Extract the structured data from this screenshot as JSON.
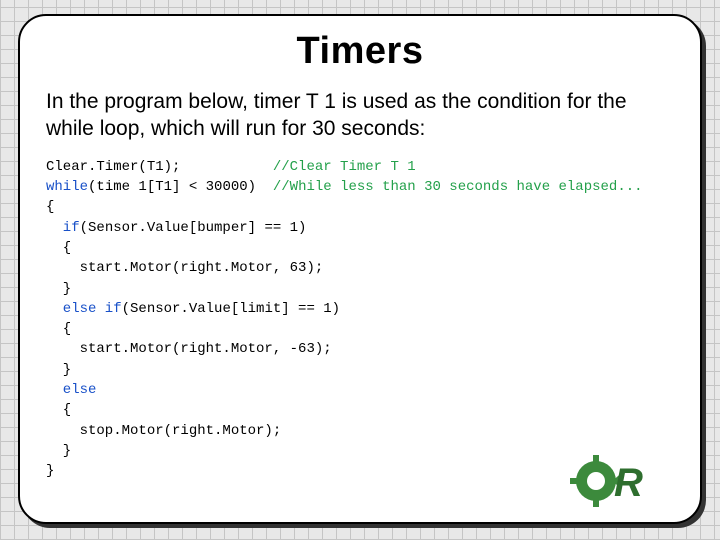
{
  "slide": {
    "title": "Timers",
    "intro": "In the program below, timer T 1 is used as the condition for the while loop, which will run for 30 seconds:",
    "code": {
      "l1a": "Clear.Timer(T1);",
      "l1b": "//Clear Timer T 1",
      "l2a": "while",
      "l2b": "(time 1[T1] < 30000)",
      "l2c": "//While less than 30 seconds have elapsed...",
      "l3": "{",
      "l4a": "  if",
      "l4b": "(Sensor.Value[bumper] == 1)",
      "l5": "  {",
      "l6": "    start.Motor(right.Motor, 63);",
      "l7": "  }",
      "l8a": "  else if",
      "l8b": "(Sensor.Value[limit] == 1)",
      "l9": "  {",
      "l10": "    start.Motor(right.Motor, -63);",
      "l11": "  }",
      "l12": "  else",
      "l13": "  {",
      "l14": "    stop.Motor(right.Motor);",
      "l15": "  }",
      "l16": "}"
    }
  },
  "logo": {
    "name": "robotc-logo"
  }
}
